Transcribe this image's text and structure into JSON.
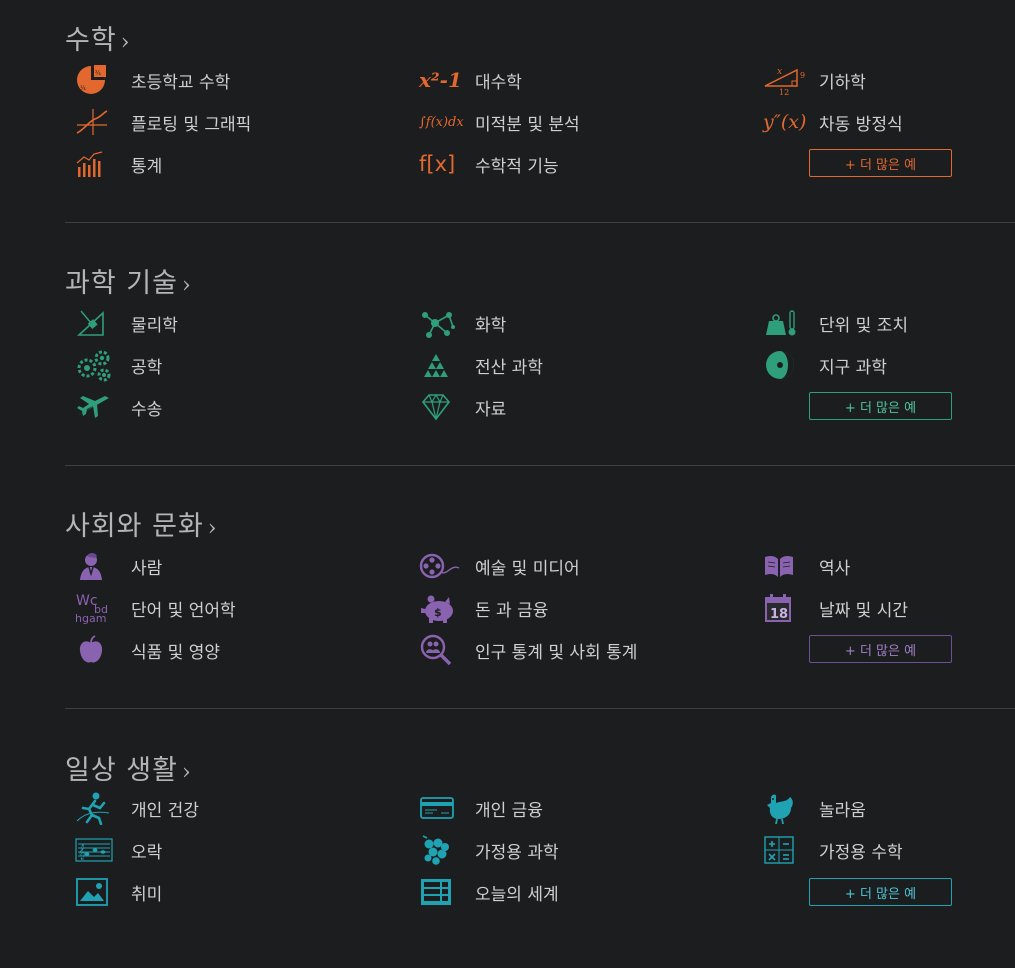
{
  "colors": {
    "math": "#e2682f",
    "science": "#2f9e7a",
    "society": "#8a63b0",
    "everyday": "#1fa3b3"
  },
  "sections": [
    {
      "title": "수학",
      "chevron": "›",
      "more": "+ 더 많은 예",
      "items": [
        {
          "label": "초등학교 수학",
          "icon": "pie-fraction-icon"
        },
        {
          "label": "대수학",
          "icon": "algebra-icon",
          "glyph": "x²-1"
        },
        {
          "label": "기하학",
          "icon": "triangle-icon",
          "glyph_a": "x",
          "glyph_b": "9",
          "glyph_c": "12"
        },
        {
          "label": "플로팅 및 그래픽",
          "icon": "plot-icon"
        },
        {
          "label": "미적분 및 분석",
          "icon": "integral-icon",
          "glyph": "∫f(x)dx"
        },
        {
          "label": "차동 방정식",
          "icon": "differential-icon",
          "glyph": "y″(x)"
        },
        {
          "label": "통계",
          "icon": "bar-chart-icon"
        },
        {
          "label": "수학적 기능",
          "icon": "function-icon",
          "glyph": "f[x]"
        }
      ]
    },
    {
      "title": "과학 기술",
      "chevron": "›",
      "more": "+ 더 많은 예",
      "items": [
        {
          "label": "물리학",
          "icon": "physics-icon"
        },
        {
          "label": "화학",
          "icon": "molecule-icon"
        },
        {
          "label": "단위 및 조치",
          "icon": "weight-thermometer-icon"
        },
        {
          "label": "공학",
          "icon": "gears-icon"
        },
        {
          "label": "전산 과학",
          "icon": "pyramid-icon"
        },
        {
          "label": "지구 과학",
          "icon": "earth-icon"
        },
        {
          "label": "수송",
          "icon": "airplane-icon"
        },
        {
          "label": "자료",
          "icon": "diamond-icon"
        }
      ]
    },
    {
      "title": "사회와 문화",
      "chevron": "›",
      "more": "+ 더 많은 예",
      "items": [
        {
          "label": "사람",
          "icon": "person-bust-icon"
        },
        {
          "label": "예술 및 미디어",
          "icon": "film-reel-icon"
        },
        {
          "label": "역사",
          "icon": "open-book-icon"
        },
        {
          "label": "단어 및 언어학",
          "icon": "words-icon",
          "glyph_a": "Wc",
          "glyph_b": "bd",
          "glyph_c": "hgam"
        },
        {
          "label": "돈 과 금융",
          "icon": "piggy-bank-icon"
        },
        {
          "label": "날짜 및 시간",
          "icon": "calendar-icon",
          "glyph": "18"
        },
        {
          "label": "식품 및 영양",
          "icon": "apple-icon"
        },
        {
          "label": "인구 통계 및 사회 통계",
          "icon": "people-magnifier-icon"
        }
      ]
    },
    {
      "title": "일상 생활",
      "chevron": "›",
      "more": "+ 더 많은 예",
      "items": [
        {
          "label": "개인 건강",
          "icon": "runner-icon"
        },
        {
          "label": "개인 금융",
          "icon": "credit-card-icon"
        },
        {
          "label": "놀라움",
          "icon": "chicken-icon"
        },
        {
          "label": "오락",
          "icon": "music-staff-icon"
        },
        {
          "label": "가정용 과학",
          "icon": "grapes-icon"
        },
        {
          "label": "가정용 수학",
          "icon": "calculator-icon"
        },
        {
          "label": "취미",
          "icon": "picture-frame-icon"
        },
        {
          "label": "오늘의 세계",
          "icon": "world-data-icon"
        }
      ]
    }
  ]
}
